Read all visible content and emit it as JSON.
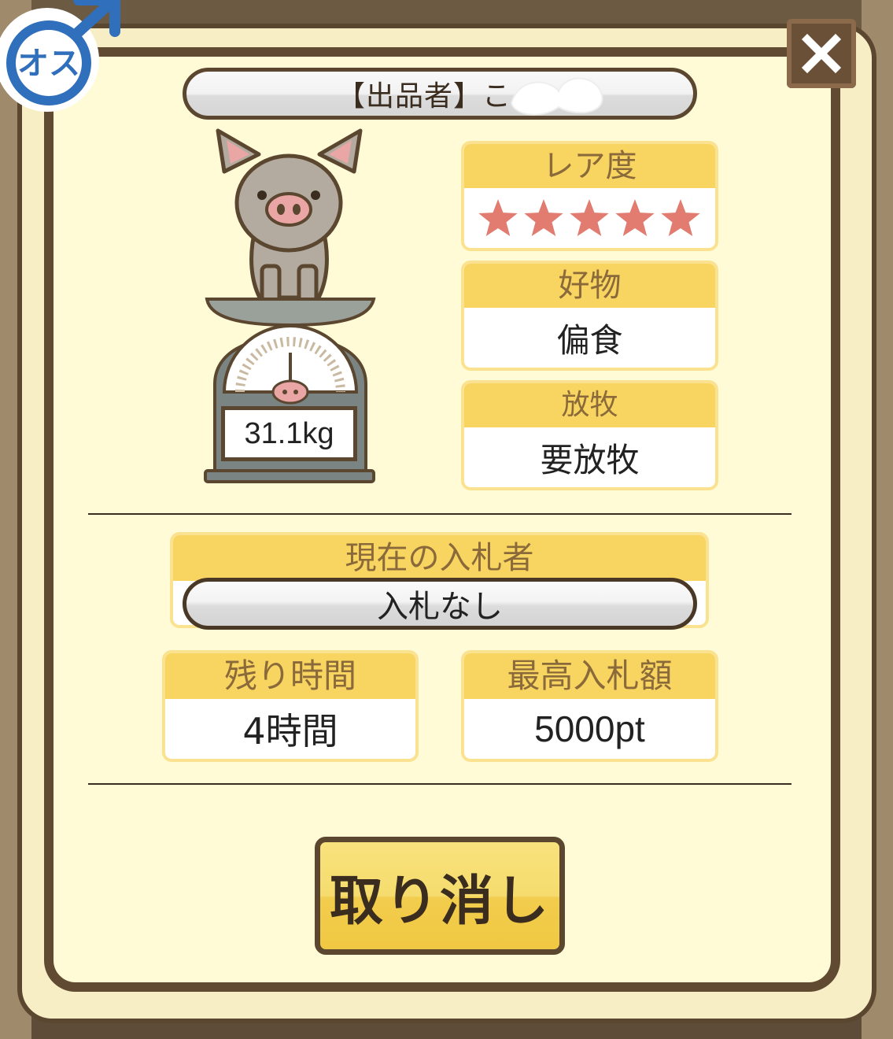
{
  "gender": {
    "label": "オス",
    "icon": "male-symbol-icon",
    "color": "#2f6fbb"
  },
  "close_icon": "close-icon",
  "seller": {
    "text": "【出品者】こ"
  },
  "weight": "31.1kg",
  "rarity": {
    "label": "レア度",
    "stars": 5,
    "star_char": "★★★★★",
    "star_color": "#e27c70"
  },
  "favorite": {
    "label": "好物",
    "value": "偏食"
  },
  "grazing": {
    "label": "放牧",
    "value": "要放牧"
  },
  "current_bidder": {
    "label": "現在の入札者",
    "value": "入札なし"
  },
  "remaining_time": {
    "label": "残り時間",
    "value": "4時間"
  },
  "max_bid": {
    "label": "最高入札額",
    "value": "5000pt"
  },
  "cancel_button": {
    "label": "取り消し"
  },
  "colors": {
    "panel": "#fffbd6",
    "header_yellow": "#f8d460",
    "frame_brown": "#604a32"
  }
}
